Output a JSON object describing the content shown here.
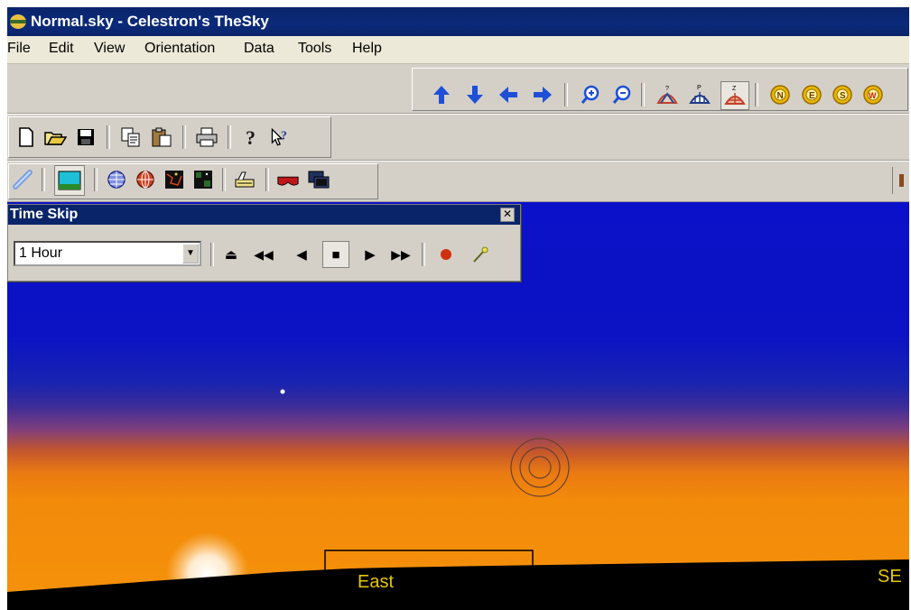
{
  "window": {
    "title": "Normal.sky - Celestron's TheSky"
  },
  "menu": [
    "File",
    "Edit",
    "View",
    "Orientation",
    "Data",
    "Tools",
    "Help"
  ],
  "nav_toolbar": {
    "buttons": [
      {
        "name": "arrow-up-icon",
        "glyph": "🡅"
      },
      {
        "name": "arrow-down-icon",
        "glyph": "🡇"
      },
      {
        "name": "arrow-left-icon",
        "glyph": "🡄"
      },
      {
        "name": "arrow-right-icon",
        "glyph": "🡆"
      },
      {
        "name": "zoom-in-icon",
        "glyph": "⊕"
      },
      {
        "name": "zoom-out-icon",
        "glyph": "⊖"
      },
      {
        "name": "horizon-view-icon",
        "glyph": "▲"
      },
      {
        "name": "pole-view-icon",
        "glyph": "▲"
      },
      {
        "name": "zenith-view-icon",
        "glyph": "▲"
      },
      {
        "name": "north-icon",
        "glyph": "N"
      },
      {
        "name": "east-icon",
        "glyph": "E"
      },
      {
        "name": "south-icon",
        "glyph": "S"
      },
      {
        "name": "west-icon",
        "glyph": "W"
      }
    ],
    "colors": {
      "arrow": "#1f4fd6",
      "dome": "#c0402a",
      "compass": "#e8b800"
    }
  },
  "standard_toolbar": {
    "buttons": [
      {
        "name": "new-file-icon",
        "glyph": "🗋"
      },
      {
        "name": "open-folder-icon",
        "glyph": "📂"
      },
      {
        "name": "save-icon",
        "glyph": "💾"
      },
      {
        "name": "copy-icon",
        "glyph": "⎘"
      },
      {
        "name": "paste-icon",
        "glyph": "📋"
      },
      {
        "name": "print-icon",
        "glyph": "🖶"
      },
      {
        "name": "help-icon",
        "glyph": "?"
      },
      {
        "name": "context-help-icon",
        "glyph": "↖?"
      }
    ]
  },
  "display_toolbar": {
    "buttons": [
      {
        "name": "link-icon",
        "glyph": "🔗"
      },
      {
        "name": "sky-display-icon",
        "glyph": "▬"
      },
      {
        "name": "grid-sphere-icon",
        "glyph": "◍"
      },
      {
        "name": "globe-icon",
        "glyph": "🌐"
      },
      {
        "name": "constellation-map-icon",
        "glyph": "▦"
      },
      {
        "name": "star-chart-icon",
        "glyph": "▦"
      },
      {
        "name": "telescope-pencil-icon",
        "glyph": "✎"
      },
      {
        "name": "glasses-icon",
        "glyph": "⛉"
      },
      {
        "name": "film-icon",
        "glyph": "▣"
      }
    ]
  },
  "time_skip": {
    "title": "Time Skip",
    "interval": "1 Hour",
    "buttons": [
      {
        "name": "eject-icon",
        "glyph": "⏏"
      },
      {
        "name": "fast-reverse-icon",
        "glyph": "⏪"
      },
      {
        "name": "step-back-icon",
        "glyph": "◀"
      },
      {
        "name": "stop-icon",
        "glyph": "■"
      },
      {
        "name": "step-forward-icon",
        "glyph": "▶"
      },
      {
        "name": "fast-forward-icon",
        "glyph": "⏩"
      },
      {
        "name": "record-icon",
        "glyph": "●"
      },
      {
        "name": "wand-icon",
        "glyph": "⁄"
      }
    ]
  },
  "sky": {
    "horizon_labels": {
      "east": "East",
      "southeast": "SE"
    },
    "colors": {
      "sky_top": "#0b11c8",
      "twilight": "#f5920a",
      "ground": "#000000",
      "label": "#e6c800"
    }
  }
}
